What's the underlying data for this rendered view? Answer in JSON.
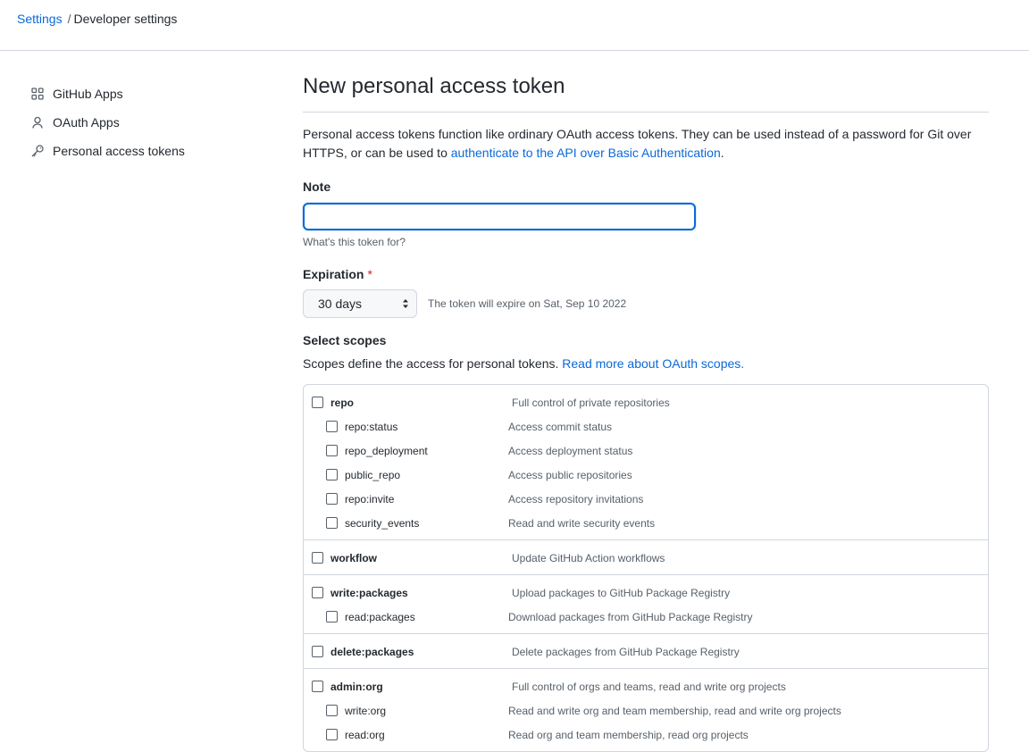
{
  "breadcrumb": {
    "root": "Settings",
    "separator": "/",
    "current": "Developer settings"
  },
  "sidebar": {
    "items": [
      {
        "label": "GitHub Apps",
        "icon": "apps-grid-icon"
      },
      {
        "label": "OAuth Apps",
        "icon": "person-icon"
      },
      {
        "label": "Personal access tokens",
        "icon": "key-icon"
      }
    ]
  },
  "main": {
    "title": "New personal access token",
    "intro_text": "Personal access tokens function like ordinary OAuth access tokens. They can be used instead of a password for Git over HTTPS, or can be used to ",
    "intro_link": "authenticate to the API over Basic Authentication",
    "intro_end": ".",
    "note": {
      "label": "Note",
      "value": "",
      "hint": "What's this token for?"
    },
    "expiration": {
      "label": "Expiration",
      "required_mark": "*",
      "selected": "30 days",
      "note": "The token will expire on Sat, Sep 10 2022"
    },
    "scopes": {
      "label": "Select scopes",
      "desc_text": "Scopes define the access for personal tokens. ",
      "desc_link": "Read more about OAuth scopes.",
      "groups": [
        {
          "name": "repo",
          "desc": "Full control of private repositories",
          "children": [
            {
              "name": "repo:status",
              "desc": "Access commit status"
            },
            {
              "name": "repo_deployment",
              "desc": "Access deployment status"
            },
            {
              "name": "public_repo",
              "desc": "Access public repositories"
            },
            {
              "name": "repo:invite",
              "desc": "Access repository invitations"
            },
            {
              "name": "security_events",
              "desc": "Read and write security events"
            }
          ]
        },
        {
          "name": "workflow",
          "desc": "Update GitHub Action workflows",
          "children": []
        },
        {
          "name": "write:packages",
          "desc": "Upload packages to GitHub Package Registry",
          "children": [
            {
              "name": "read:packages",
              "desc": "Download packages from GitHub Package Registry"
            }
          ]
        },
        {
          "name": "delete:packages",
          "desc": "Delete packages from GitHub Package Registry",
          "children": []
        },
        {
          "name": "admin:org",
          "desc": "Full control of orgs and teams, read and write org projects",
          "children": [
            {
              "name": "write:org",
              "desc": "Read and write org and team membership, read and write org projects"
            },
            {
              "name": "read:org",
              "desc": "Read org and team membership, read org projects"
            }
          ]
        }
      ]
    }
  },
  "colors": {
    "link": "#0969da",
    "border": "#d0d7de",
    "muted": "#57606a",
    "required": "#cf222e"
  }
}
